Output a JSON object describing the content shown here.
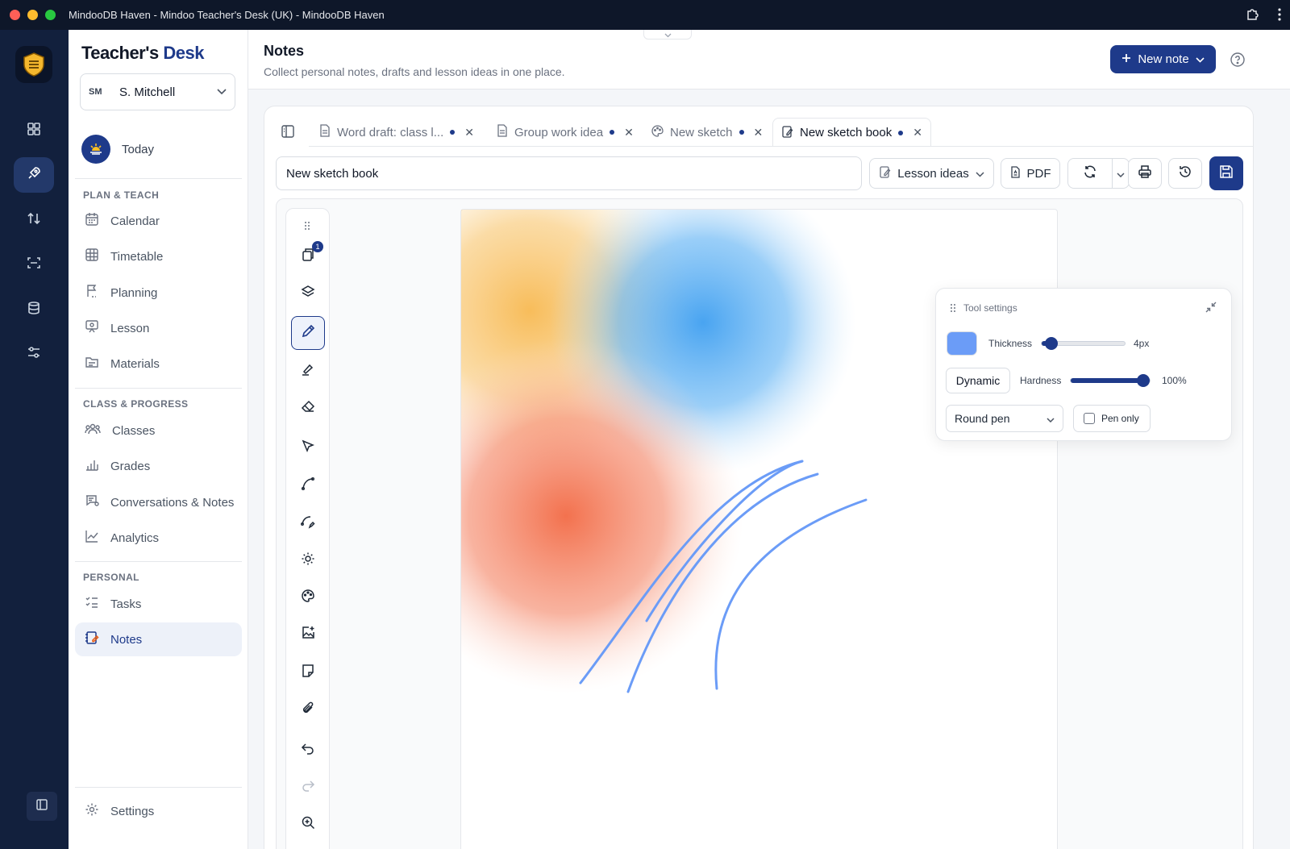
{
  "window": {
    "title": "MindooDB Haven - Mindoo Teacher's Desk (UK) - MindooDB Haven"
  },
  "brand": {
    "part1": "Teacher's",
    "part2": "Desk"
  },
  "user": {
    "initials": "SM",
    "name": "S. Mitchell"
  },
  "sidebar": {
    "today": "Today",
    "sections": [
      {
        "label": "PLAN & TEACH",
        "items": [
          "Calendar",
          "Timetable",
          "Planning",
          "Lesson",
          "Materials"
        ]
      },
      {
        "label": "CLASS & PROGRESS",
        "items": [
          "Classes",
          "Grades",
          "Conversations & Notes",
          "Analytics"
        ]
      },
      {
        "label": "PERSONAL",
        "items": [
          "Tasks",
          "Notes"
        ]
      }
    ],
    "active_item": "Notes",
    "settings": "Settings"
  },
  "header": {
    "title": "Notes",
    "subtitle": "Collect personal notes, drafts and lesson ideas in one place.",
    "new_note_label": "New note"
  },
  "tabs": [
    {
      "label": "Word draft: class l...",
      "icon": "document-icon",
      "unsaved": true
    },
    {
      "label": "Group work idea",
      "icon": "document-icon",
      "unsaved": true
    },
    {
      "label": "New sketch",
      "icon": "palette-icon",
      "unsaved": true
    },
    {
      "label": "New sketch book",
      "icon": "sketchbook-icon",
      "unsaved": true,
      "active": true
    }
  ],
  "editor": {
    "title_value": "New sketch book",
    "folder": "Lesson ideas",
    "pdf_label": "PDF",
    "pages_badge": "1"
  },
  "tool_settings": {
    "title": "Tool settings",
    "color": "#6b9cf7",
    "thickness_label": "Thickness",
    "thickness_value": "4px",
    "dynamic_label": "Dynamic",
    "hardness_label": "Hardness",
    "hardness_value": "100%",
    "hardness_level": 1.0,
    "thickness_level": 0.05,
    "pen_type": "Round pen",
    "pen_only_label": "Pen only",
    "pen_only_checked": false
  },
  "colors": {
    "accent": "#1e3a8a",
    "rail": "#12203d",
    "stroke": "#6b9cf7"
  }
}
